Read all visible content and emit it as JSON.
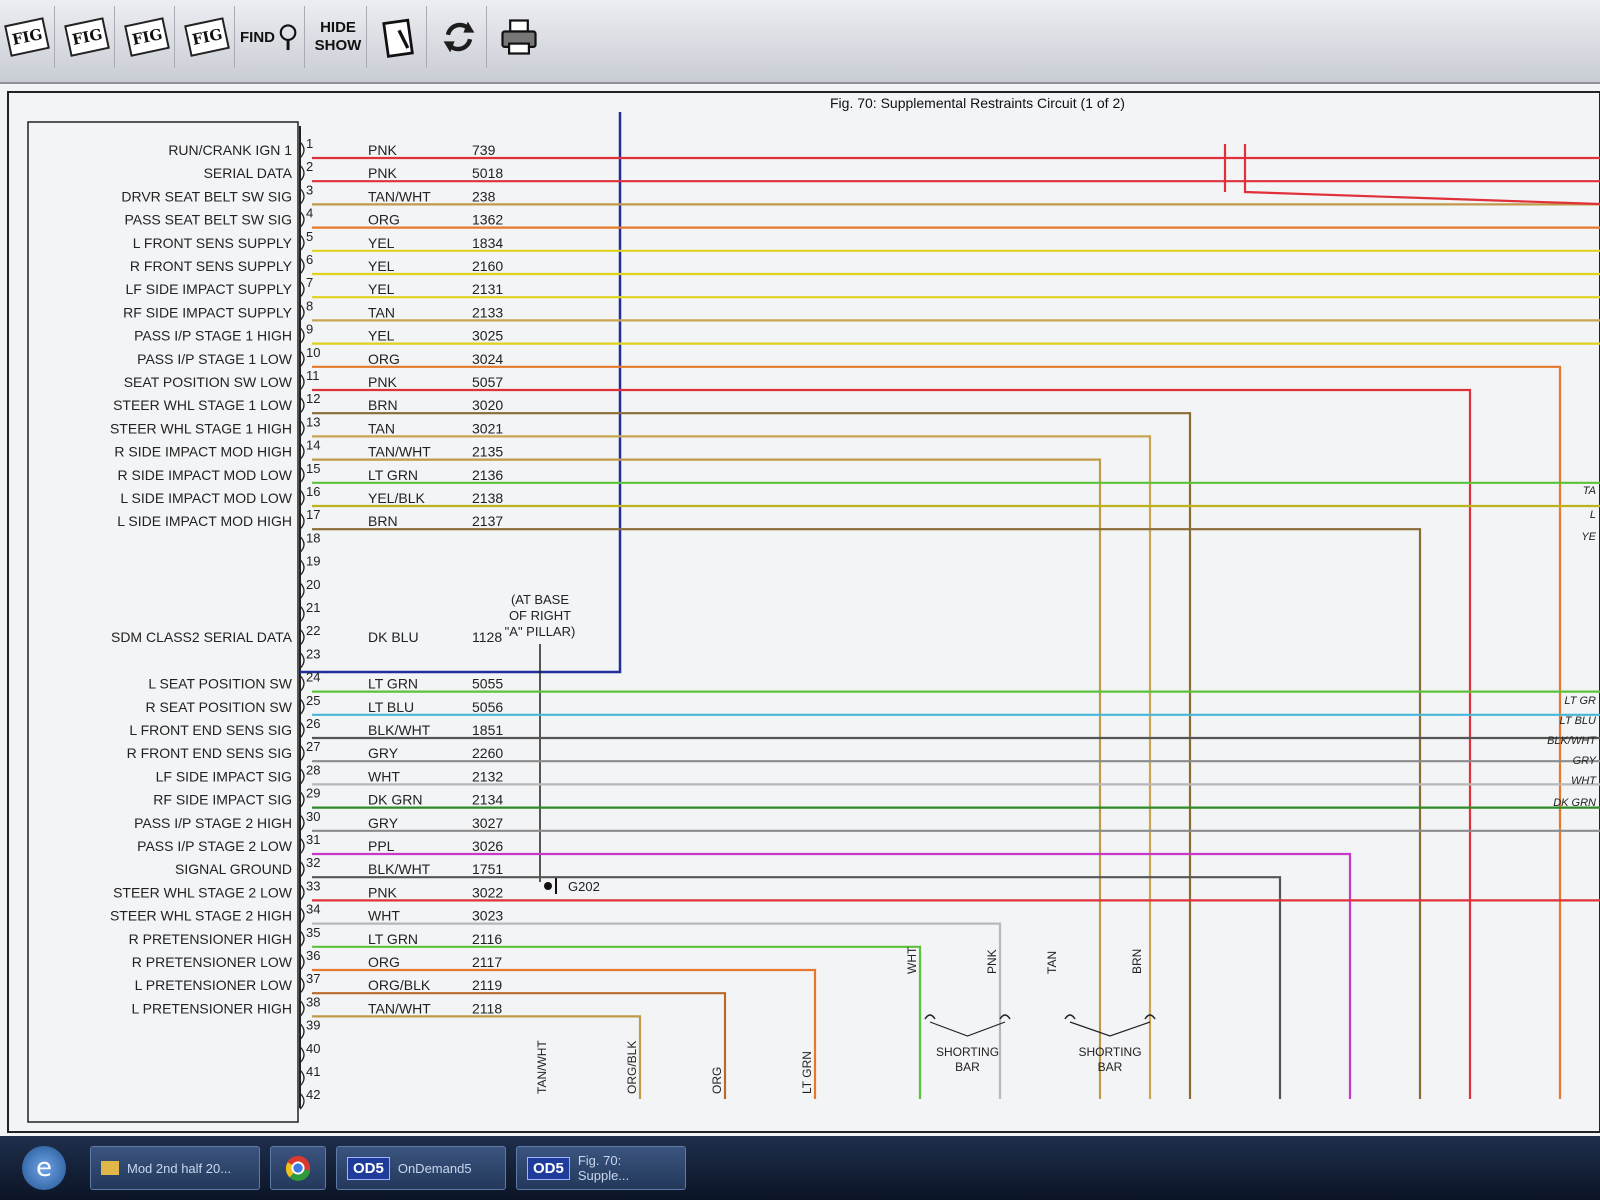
{
  "toolbar": {
    "buttons": [
      {
        "name": "fig-button",
        "label": "FIG"
      },
      {
        "name": "fig-hand-button",
        "label": "FIG"
      },
      {
        "name": "fig-prev-button",
        "label": "FIG"
      },
      {
        "name": "fig-next-button",
        "label": "FIG"
      },
      {
        "name": "find-button",
        "label": "FIND"
      },
      {
        "name": "hide-show-button",
        "label_top": "HIDE",
        "label_bottom": "SHOW"
      }
    ]
  },
  "diagram": {
    "title": "Fig. 70: Supplemental Restraints Circuit (1 of 2)",
    "location_note": [
      "(AT BASE",
      "OF RIGHT",
      "\"A\" PILLAR)"
    ],
    "ground_label": "G202",
    "shorting_bar_label": [
      "SHORTING",
      "BAR"
    ],
    "pins": [
      {
        "pin": "1",
        "label": "RUN/CRANK IGN 1",
        "color": "PNK",
        "circuit": "739",
        "wire_color": "#e0303a"
      },
      {
        "pin": "2",
        "label": "SERIAL DATA",
        "color": "PNK",
        "circuit": "5018",
        "wire_color": "#e0303a"
      },
      {
        "pin": "3",
        "label": "DRVR SEAT BELT SW SIG",
        "color": "TAN/WHT",
        "circuit": "238",
        "wire_color": "#c09a4a"
      },
      {
        "pin": "4",
        "label": "PASS SEAT BELT SW SIG",
        "color": "ORG",
        "circuit": "1362",
        "wire_color": "#e5782a"
      },
      {
        "pin": "5",
        "label": "L FRONT SENS SUPPLY",
        "color": "YEL",
        "circuit": "1834",
        "wire_color": "#dfd21c"
      },
      {
        "pin": "6",
        "label": "R FRONT SENS SUPPLY",
        "color": "YEL",
        "circuit": "2160",
        "wire_color": "#dfd21c"
      },
      {
        "pin": "7",
        "label": "LF SIDE IMPACT SUPPLY",
        "color": "YEL",
        "circuit": "2131",
        "wire_color": "#dfd21c"
      },
      {
        "pin": "8",
        "label": "RF SIDE IMPACT SUPPLY",
        "color": "TAN",
        "circuit": "2133",
        "wire_color": "#c9a553"
      },
      {
        "pin": "9",
        "label": "PASS I/P STAGE 1 HIGH",
        "color": "YEL",
        "circuit": "3025",
        "wire_color": "#dfd21c"
      },
      {
        "pin": "10",
        "label": "PASS I/P STAGE 1 LOW",
        "color": "ORG",
        "circuit": "3024",
        "wire_color": "#e5782a"
      },
      {
        "pin": "11",
        "label": "SEAT POSITION SW LOW",
        "color": "PNK",
        "circuit": "5057",
        "wire_color": "#e0303a"
      },
      {
        "pin": "12",
        "label": "STEER WHL STAGE 1 LOW",
        "color": "BRN",
        "circuit": "3020",
        "wire_color": "#8a6a35"
      },
      {
        "pin": "13",
        "label": "STEER WHL STAGE 1 HIGH",
        "color": "TAN",
        "circuit": "3021",
        "wire_color": "#c9a553"
      },
      {
        "pin": "14",
        "label": "R SIDE IMPACT MOD HIGH",
        "color": "TAN/WHT",
        "circuit": "2135",
        "wire_color": "#c09a4a"
      },
      {
        "pin": "15",
        "label": "R SIDE IMPACT MOD LOW",
        "color": "LT GRN",
        "circuit": "2136",
        "wire_color": "#5cc23a"
      },
      {
        "pin": "16",
        "label": "L SIDE IMPACT MOD LOW",
        "color": "YEL/BLK",
        "circuit": "2138",
        "wire_color": "#bdb21a"
      },
      {
        "pin": "17",
        "label": "L SIDE IMPACT MOD HIGH",
        "color": "BRN",
        "circuit": "2137",
        "wire_color": "#8a6a35"
      },
      {
        "pin": "18"
      },
      {
        "pin": "19"
      },
      {
        "pin": "20"
      },
      {
        "pin": "21"
      },
      {
        "pin": "22",
        "label": "SDM CLASS2 SERIAL DATA",
        "color": "DK BLU",
        "circuit": "1128",
        "wire_color": "#1f2e9a"
      },
      {
        "pin": "23"
      },
      {
        "pin": "24",
        "label": "L SEAT POSITION SW",
        "color": "LT GRN",
        "circuit": "5055",
        "wire_color": "#5cc23a"
      },
      {
        "pin": "25",
        "label": "R SEAT POSITION SW",
        "color": "LT BLU",
        "circuit": "5056",
        "wire_color": "#48b6d8"
      },
      {
        "pin": "26",
        "label": "L FRONT END SENS SIG",
        "color": "BLK/WHT",
        "circuit": "1851",
        "wire_color": "#555555"
      },
      {
        "pin": "27",
        "label": "R FRONT END SENS SIG",
        "color": "GRY",
        "circuit": "2260",
        "wire_color": "#8c8c8c"
      },
      {
        "pin": "28",
        "label": "LF SIDE IMPACT SIG",
        "color": "WHT",
        "circuit": "2132",
        "wire_color": "#b8b8b8"
      },
      {
        "pin": "29",
        "label": "RF SIDE IMPACT SIG",
        "color": "DK GRN",
        "circuit": "2134",
        "wire_color": "#2f8a2a"
      },
      {
        "pin": "30",
        "label": "PASS I/P STAGE 2 HIGH",
        "color": "GRY",
        "circuit": "3027",
        "wire_color": "#8c8c8c"
      },
      {
        "pin": "31",
        "label": "PASS I/P STAGE 2 LOW",
        "color": "PPL",
        "circuit": "3026",
        "wire_color": "#c838c8"
      },
      {
        "pin": "32",
        "label": "SIGNAL GROUND",
        "color": "BLK/WHT",
        "circuit": "1751",
        "wire_color": "#555555"
      },
      {
        "pin": "33",
        "label": "STEER WHL STAGE 2 LOW",
        "color": "PNK",
        "circuit": "3022",
        "wire_color": "#e0303a"
      },
      {
        "pin": "34",
        "label": "STEER WHL STAGE 2 HIGH",
        "color": "WHT",
        "circuit": "3023",
        "wire_color": "#b8b8b8"
      },
      {
        "pin": "35",
        "label": "R PRETENSIONER HIGH",
        "color": "LT GRN",
        "circuit": "2116",
        "wire_color": "#5cc23a"
      },
      {
        "pin": "36",
        "label": "R PRETENSIONER LOW",
        "color": "ORG",
        "circuit": "2117",
        "wire_color": "#e5782a"
      },
      {
        "pin": "37",
        "label": "L PRETENSIONER LOW",
        "color": "ORG/BLK",
        "circuit": "2119",
        "wire_color": "#b86a2a"
      },
      {
        "pin": "38",
        "label": "L PRETENSIONER HIGH",
        "color": "TAN/WHT",
        "circuit": "2118",
        "wire_color": "#c09a4a"
      },
      {
        "pin": "39"
      },
      {
        "pin": "40"
      },
      {
        "pin": "41"
      },
      {
        "pin": "42"
      }
    ],
    "drop_labels": [
      "TAN/WHT",
      "ORG/BLK",
      "ORG",
      "LT GRN",
      "WHT",
      "PNK",
      "TAN",
      "BRN"
    ],
    "right_edge_labels": [
      "TA",
      "L",
      "YE",
      "LT GR",
      "LT BLU",
      "BLK/WHT",
      "GRY",
      "WHT",
      "DK GRN"
    ]
  },
  "taskbar": {
    "items": [
      {
        "name": "taskbar-item-mod",
        "label": "Mod 2nd half 20..."
      },
      {
        "name": "taskbar-item-ondemand",
        "badge": "OD5",
        "label": "OnDemand5"
      },
      {
        "name": "taskbar-item-fig70",
        "badge": "OD5",
        "label": "Fig. 70: Supple..."
      }
    ]
  }
}
